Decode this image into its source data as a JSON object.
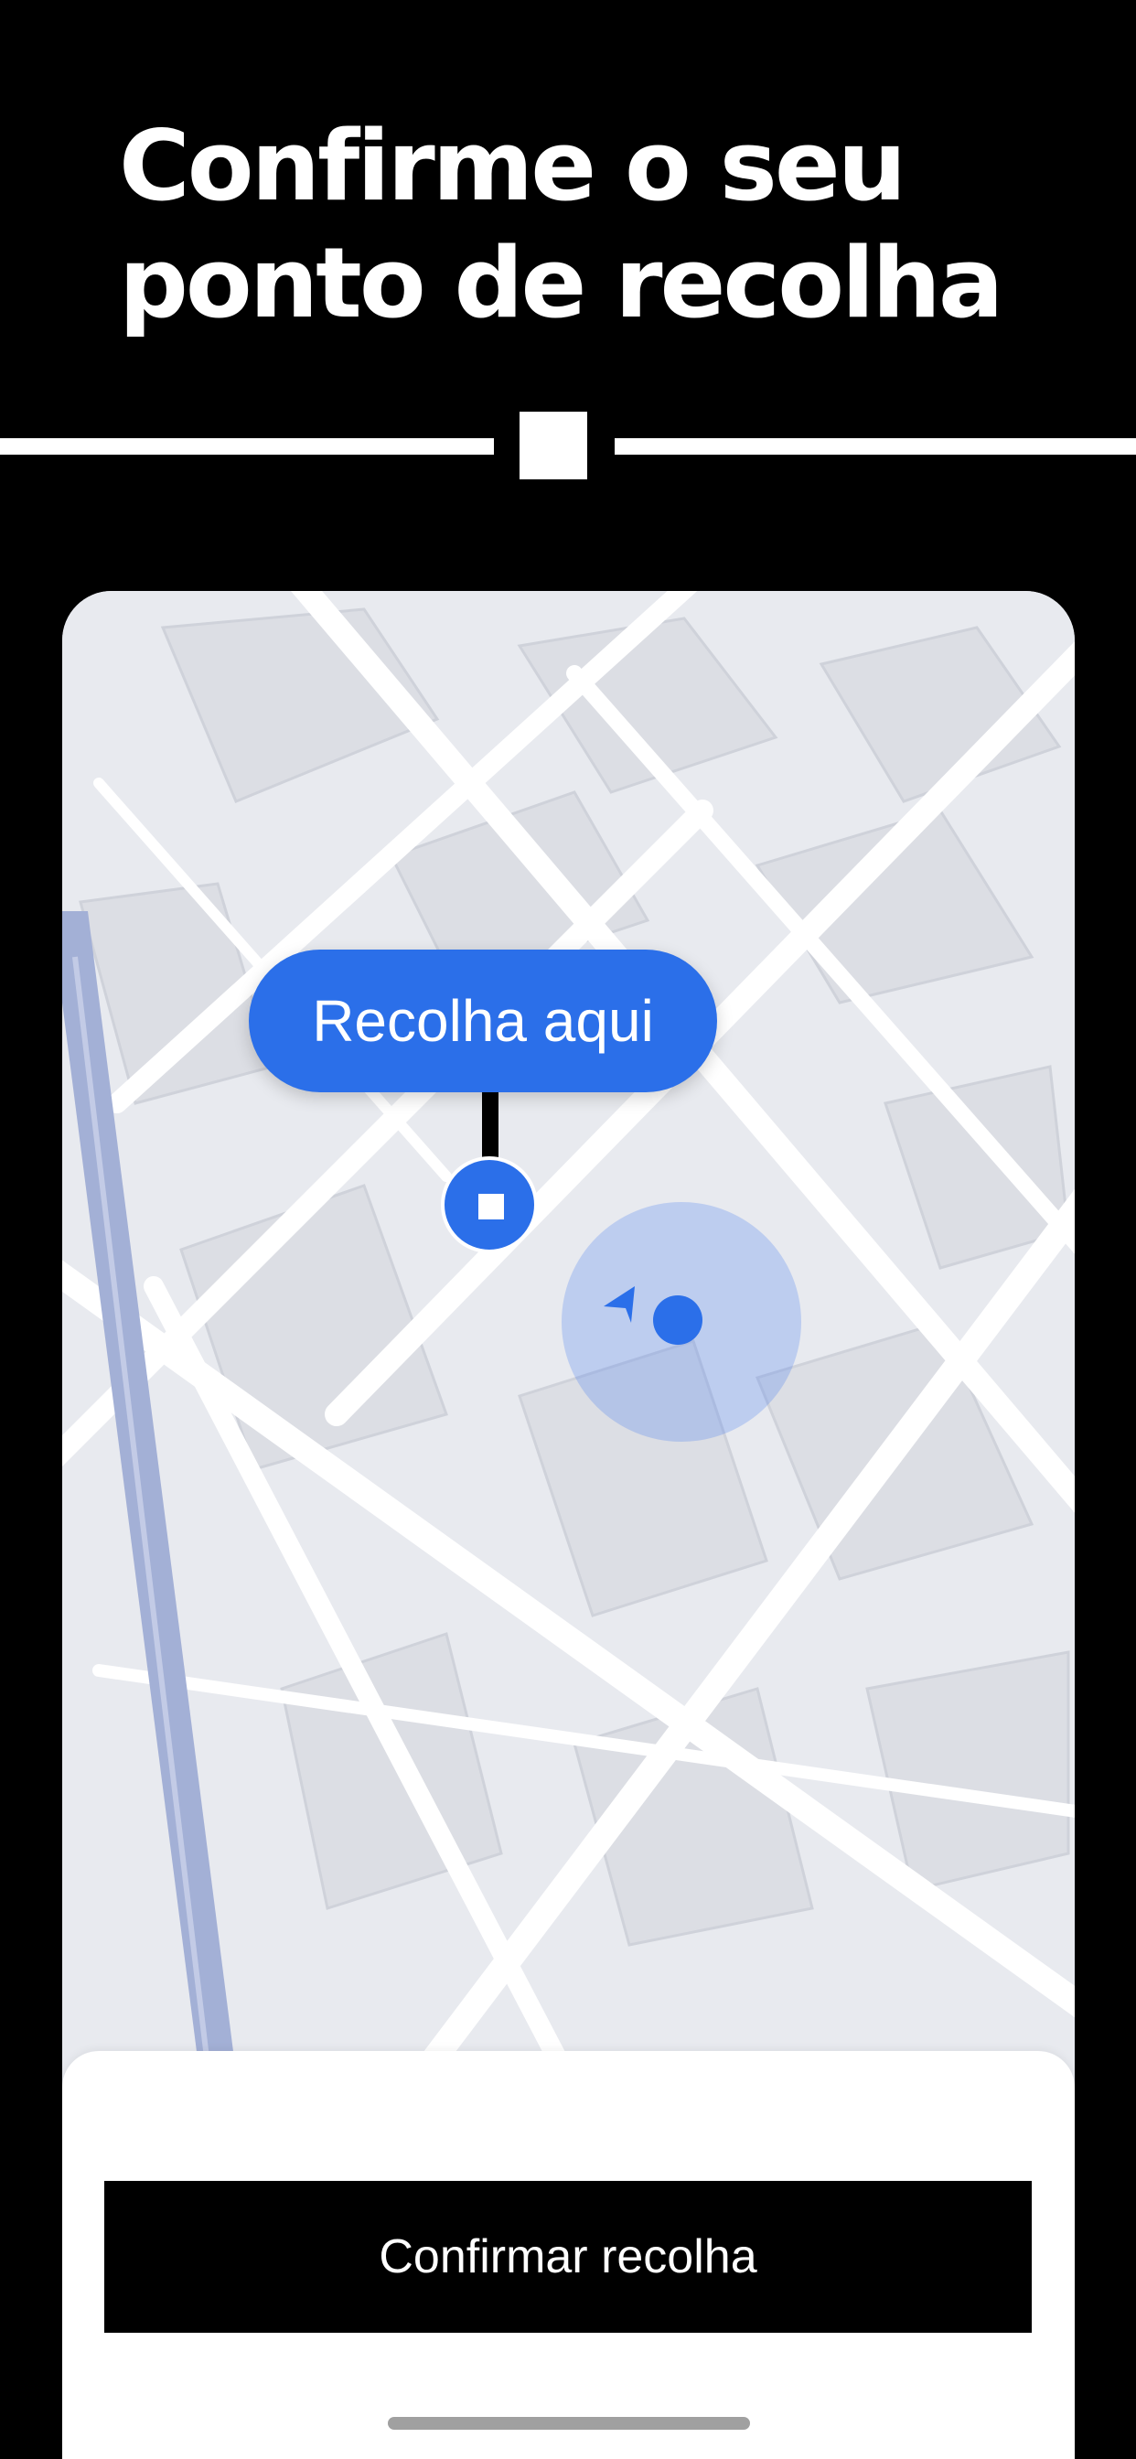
{
  "header": {
    "title_line1": "Confirme o seu",
    "title_line2": "ponto de recolha"
  },
  "map": {
    "pickup_callout_label": "Recolha aqui"
  },
  "bottom_sheet": {
    "confirm_button_label": "Confirmar recolha"
  },
  "colors": {
    "background": "#000000",
    "accent_blue": "#2B6FE9",
    "map_base": "#E8EAEF",
    "road": "#FFFFFF",
    "highway": "#A3B0D6"
  },
  "icons": [
    "pickup-pin-icon",
    "current-location-dot-icon",
    "heading-arrow-icon"
  ]
}
